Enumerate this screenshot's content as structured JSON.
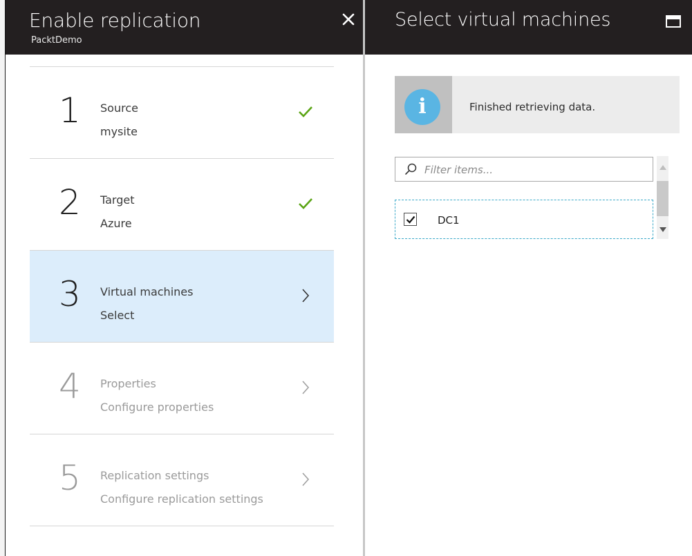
{
  "left_blade": {
    "title": "Enable replication",
    "subtitle": "PacktDemo",
    "close_icon": "close-icon",
    "steps": [
      {
        "number": "1",
        "name": "Source",
        "value": "mysite",
        "state": "completed",
        "icon": "checkmark-icon"
      },
      {
        "number": "2",
        "name": "Target",
        "value": "Azure",
        "state": "completed",
        "icon": "checkmark-icon"
      },
      {
        "number": "3",
        "name": "Virtual machines",
        "value": "Select",
        "state": "active",
        "icon": "chevron-right-icon"
      },
      {
        "number": "4",
        "name": "Properties",
        "value": "Configure properties",
        "state": "disabled",
        "icon": "chevron-right-icon"
      },
      {
        "number": "5",
        "name": "Replication settings",
        "value": "Configure replication settings",
        "state": "disabled",
        "icon": "chevron-right-icon"
      }
    ]
  },
  "right_blade": {
    "title": "Select virtual machines",
    "maximize_icon": "maximize-icon",
    "info": {
      "icon": "info-icon",
      "glyph": "i",
      "message": "Finished retrieving data."
    },
    "filter": {
      "placeholder": "Filter items...",
      "value": "",
      "icon": "search-icon"
    },
    "vms": [
      {
        "name": "DC1",
        "checked": true
      }
    ]
  },
  "colors": {
    "header_bg": "#231f20",
    "active_step_bg": "#dcedfb",
    "check_green": "#5aa414",
    "info_blue": "#5ab5e3",
    "focus_border": "#38a8c8"
  }
}
